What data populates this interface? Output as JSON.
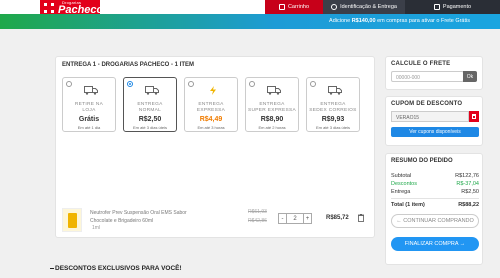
{
  "header": {
    "logo_small": "Drogarias",
    "logo_name": "Pacheco",
    "steps": [
      {
        "label": "Carrinho"
      },
      {
        "label": "Identificação & Entrega"
      },
      {
        "label": "Pagamento"
      }
    ]
  },
  "promo": {
    "prefix": "Adicione ",
    "amount": "R$140,00",
    "suffix": " em compras para ativar o Frete Grátis"
  },
  "delivery": {
    "title": "ENTREGA 1 - DROGARIAS PACHECO - 1 ITEM",
    "options": [
      {
        "line1": "RETIRE NA",
        "line2": "LOJA",
        "price": "Grátis",
        "eta": "Em até 1 dia",
        "selected": false,
        "icon": "truck-icon"
      },
      {
        "line1": "ENTREGA",
        "line2": "NORMAL",
        "price": "R$2,50",
        "eta": "Em até 3 dias úteis",
        "selected": true,
        "icon": "truck-icon"
      },
      {
        "line1": "ENTREGA",
        "line2": "EXPRESSA",
        "price": "R$4,49",
        "eta": "Em até 3 horas",
        "selected": false,
        "icon": "lightning-icon"
      },
      {
        "line1": "ENTREGA",
        "line2": "SUPER EXPRESSA",
        "price": "R$8,90",
        "eta": "Em até 2 horas",
        "selected": false,
        "icon": "truck-icon"
      },
      {
        "line1": "ENTREGA",
        "line2": "SEDEX CORREIOS",
        "price": "R$9,93",
        "eta": "Em até 3 dias úteis",
        "selected": false,
        "icon": "truck-icon"
      }
    ]
  },
  "item": {
    "description": "Neutrofer Prev Suspensão Oral EMS Sabor Chocolate e Brigadeiro 60ml",
    "unit": "1ml",
    "old_price_1": "R$61,93",
    "old_price_2": "R$42,86",
    "quantity": "2",
    "minus": "-",
    "plus": "+",
    "price": "R$85,72"
  },
  "freight": {
    "title": "CALCULE O FRETE",
    "placeholder": "00000-000",
    "ok": "Ok"
  },
  "coupon": {
    "title": "CUPOM DE DESCONTO",
    "code": "VERAO15",
    "view_button": "Ver cupons disponíveis"
  },
  "summary": {
    "title": "RESUMO DO PEDIDO",
    "subtotal_label": "Subtotal",
    "subtotal": "R$122,76",
    "discount_label": "Descontos",
    "discount": "R$-37,04",
    "shipping_label": "Entrega",
    "shipping": "R$2,50",
    "total_label": "Total (1 item)",
    "total": "R$88,22",
    "continue_button": "← CONTINUAR COMPRANDO",
    "finish_button": "FINALIZAR COMPRA →"
  },
  "bottom_heading": "DESCONTOS EXCLUSIVOS PARA VOCÊ!",
  "colors": {
    "brand_red": "#e2001a",
    "accent_blue": "#2196f3",
    "green": "#1fa84a",
    "orange": "#f07c00"
  }
}
